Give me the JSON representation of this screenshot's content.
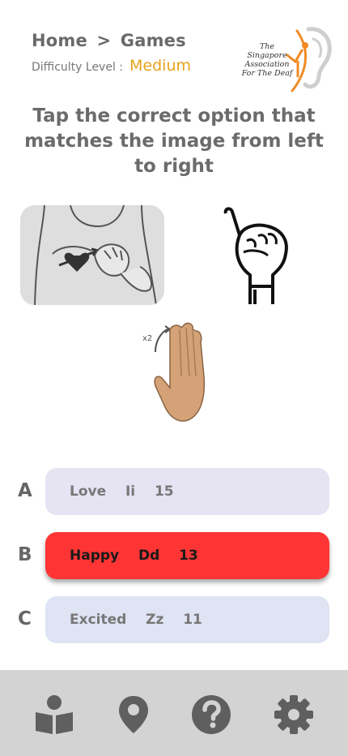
{
  "header": {
    "breadcrumb_home": "Home",
    "breadcrumb_sep": ">",
    "breadcrumb_current": "Games",
    "difficulty_label": "Difficulty Level :",
    "difficulty_value": "Medium"
  },
  "logo": {
    "line1": "The Singapore",
    "line2": "Association",
    "line3": "For The Deaf"
  },
  "instruction": "Tap the correct option that matches the image from left to right",
  "images": {
    "img3_annotation": "x2"
  },
  "options": [
    {
      "letter": "A",
      "label": "Love  Ii  15",
      "state": "default"
    },
    {
      "letter": "B",
      "label": "Happy  Dd  13",
      "state": "selected"
    },
    {
      "letter": "C",
      "label": "Excited  Zz  11",
      "state": "default"
    }
  ],
  "nav": [
    {
      "icon": "book-reader-icon"
    },
    {
      "icon": "map-marker-icon"
    },
    {
      "icon": "question-circle-icon"
    },
    {
      "icon": "gear-icon"
    }
  ],
  "colors": {
    "accent": "#e8a21c",
    "selected": "#ff3535",
    "nav_bg": "#d3d3d3",
    "icon": "#5f5f5f"
  }
}
